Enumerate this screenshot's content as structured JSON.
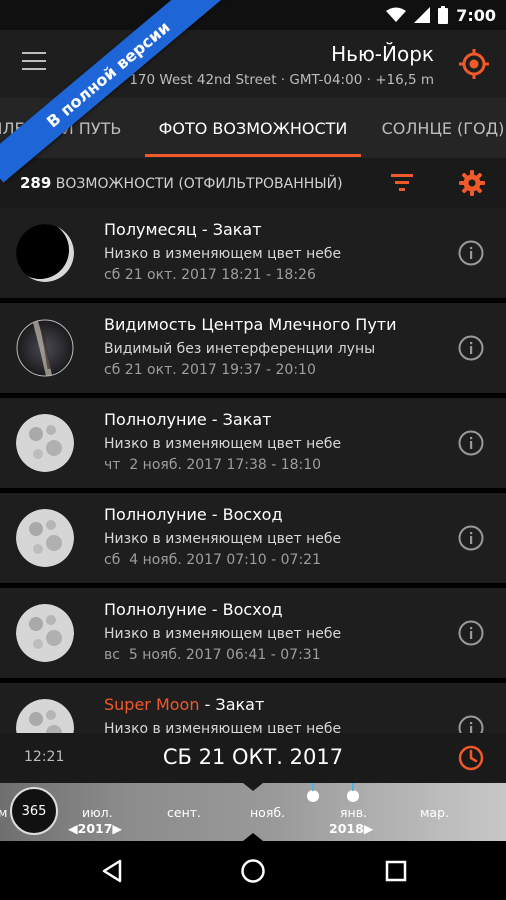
{
  "status_bar": {
    "time": "7:00"
  },
  "header": {
    "city": "Нью-Йорк",
    "address": "170 West 42nd Street",
    "timezone": "GMT-04:00",
    "elevation": "+16,5 m"
  },
  "promo_ribbon": "В полной версии",
  "tabs": [
    {
      "label": "МЛЕЧНЫЙ ПУТЬ"
    },
    {
      "label": "ФОТО ВОЗМОЖНОСТИ",
      "active": true
    },
    {
      "label": "СОЛНЦЕ (ГОД)"
    }
  ],
  "filter_bar": {
    "count": "289",
    "label": "ВОЗМОЖНОСТИ (ОТФИЛЬТРОВАННЫЙ)"
  },
  "items": [
    {
      "title": "Полумесяц - Закат",
      "subtitle": "Низко в изменяющем цвет небе",
      "date": "сб 21 окт. 2017 18:21 - 18:26",
      "thumb": "crescent-moon"
    },
    {
      "title": "Видимость Центра Млечного Пути",
      "subtitle": "Видимый без инетерференции луны",
      "date": "сб 21 окт. 2017 19:37 - 20:10",
      "thumb": "milky-way"
    },
    {
      "title": "Полнолуние - Закат",
      "subtitle": "Низко в изменяющем цвет небе",
      "date": "чт  2 нояб. 2017 17:38 - 18:10",
      "thumb": "full-moon"
    },
    {
      "title": "Полнолуние - Восход",
      "subtitle": "Низко в изменяющем цвет небе",
      "date": "сб  4 нояб. 2017 07:10 - 07:21",
      "thumb": "full-moon"
    },
    {
      "title": "Полнолуние - Восход",
      "subtitle": "Низко в изменяющем цвет небе",
      "date": "вс  5 нояб. 2017 06:41 - 07:31",
      "thumb": "full-moon"
    },
    {
      "title_accent": "Super Moon",
      "title_rest": " - Закат",
      "subtitle": "Низко в изменяющем цвет небе",
      "date": "",
      "thumb": "full-moon"
    }
  ],
  "date_bar": {
    "time": "12:21",
    "date": "СБ 21 ОКТ. 2017"
  },
  "timeline": {
    "day_of_year": "365",
    "months": [
      "м",
      "июл.",
      "сент.",
      "нояб.",
      "янв.",
      "мар."
    ],
    "years": [
      "2017",
      "2018"
    ]
  },
  "colors": {
    "accent": "#f0592a",
    "ribbon": "#1e66d8",
    "card": "#1e1e1e"
  }
}
